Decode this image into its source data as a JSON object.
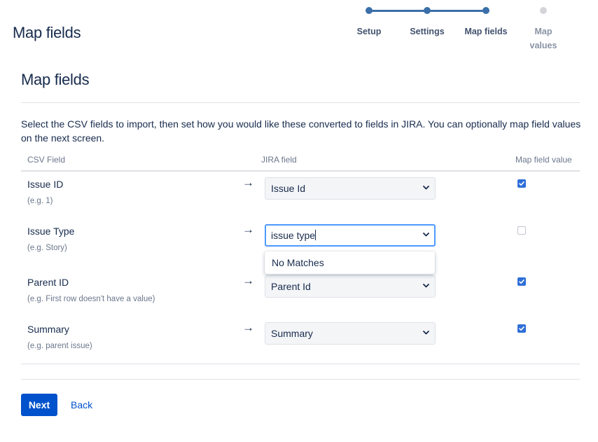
{
  "header": {
    "title": "Map fields"
  },
  "progress": {
    "steps": [
      {
        "label": "Setup",
        "state": "complete"
      },
      {
        "label": "Settings",
        "state": "complete"
      },
      {
        "label": "Map fields",
        "state": "current"
      },
      {
        "label_line1": "Map",
        "label_line2": "values",
        "state": "upcoming"
      }
    ],
    "active_color": "#3b6faa",
    "inactive_color": "#d3d5d9"
  },
  "main": {
    "title": "Map fields",
    "description": "Select the CSV fields to import, then set how you would like these converted to fields in JIRA. You can optionally map field values on the next screen.",
    "columns": {
      "csv_field": "CSV Field",
      "jira_field": "JIRA field",
      "map_value": "Map field value"
    },
    "rows": [
      {
        "name": "Issue ID",
        "example": "(e.g. 1)",
        "jira_field": "Issue Id",
        "map_value": true
      },
      {
        "name": "Issue Type",
        "example": "(e.g. Story)",
        "jira_field": "issue type",
        "map_value": false,
        "focused": true
      },
      {
        "name": "Parent ID",
        "example": "(e.g. First row doesn't have a value)",
        "jira_field": "Parent Id",
        "map_value": true
      },
      {
        "name": "Summary",
        "example": "(e.g. parent issue)",
        "jira_field": "Summary",
        "map_value": true
      }
    ],
    "dropdown": {
      "message": "No Matches"
    }
  },
  "actions": {
    "next_label": "Next",
    "back_label": "Back",
    "primary_color": "#0052cc"
  }
}
